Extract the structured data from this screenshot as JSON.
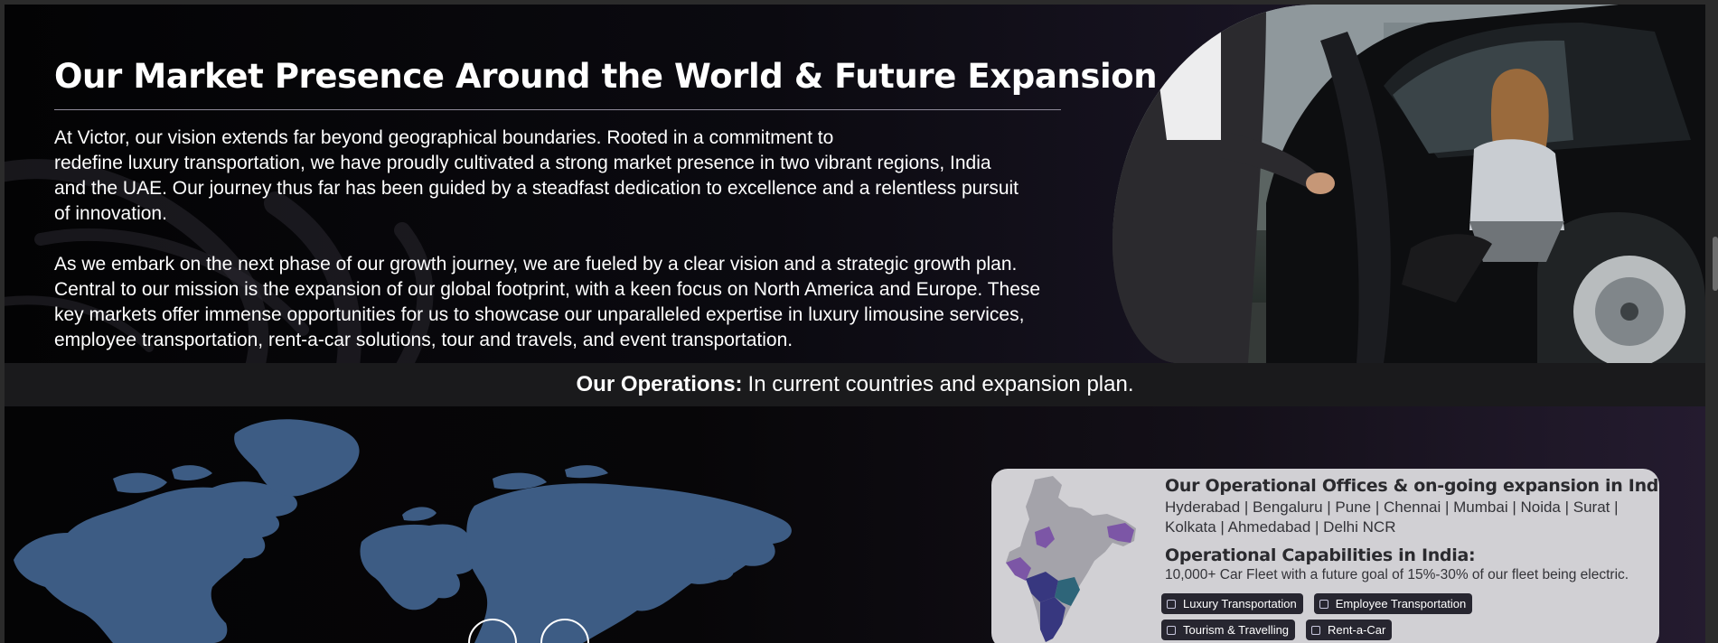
{
  "hero": {
    "title": "Our Market Presence Around the World & Future Expansion",
    "paragraph_1": "At Victor, our vision extends far beyond geographical boundaries. Rooted in a commitment to\nredefine luxury transportation, we have proudly cultivated a strong market presence in two vibrant regions, India\nand the UAE. Our journey thus far has been guided by a steadfast dedication to excellence and a relentless pursuit\nof innovation.",
    "paragraph_2": "As we embark on the next phase of our growth journey, we are fueled by a clear vision and a strategic growth plan.\nCentral to our mission is the expansion of our global footprint, with a keen focus on North America and Europe. These\nkey markets offer immense opportunities for us to showcase our unparalleled expertise in luxury limousine services,\nemployee transportation, rent-a-car solutions, tour and travels, and event transportation."
  },
  "operations": {
    "label": "Our Operations:",
    "text": "In current countries and expansion plan."
  },
  "india_card": {
    "offices_heading": "Our Operational Offices & on-going expansion in India:",
    "cities": "Hyderabad | Bengaluru | Pune | Chennai | Mumbai | Noida | Surat | Kolkata | Ahmedabad | Delhi NCR",
    "capabilities_heading": "Operational Capabilities in India:",
    "capabilities_text": "10,000+ Car Fleet with a future goal of 15%-30% of our fleet being electric.",
    "services": [
      {
        "label": "Luxury Transportation"
      },
      {
        "label": "Employee Transportation"
      },
      {
        "label": "Tourism & Travelling"
      },
      {
        "label": "Rent-a-Car"
      }
    ]
  },
  "colors": {
    "map_land": "#3d5c84",
    "india_purple": "#7c56a6",
    "india_blue": "#37377f",
    "india_teal": "#2e6579",
    "card_bg": "#d1d0d4",
    "tag_bg": "#272630"
  },
  "icons": {
    "tag_checkbox": "checkbox-icon"
  }
}
